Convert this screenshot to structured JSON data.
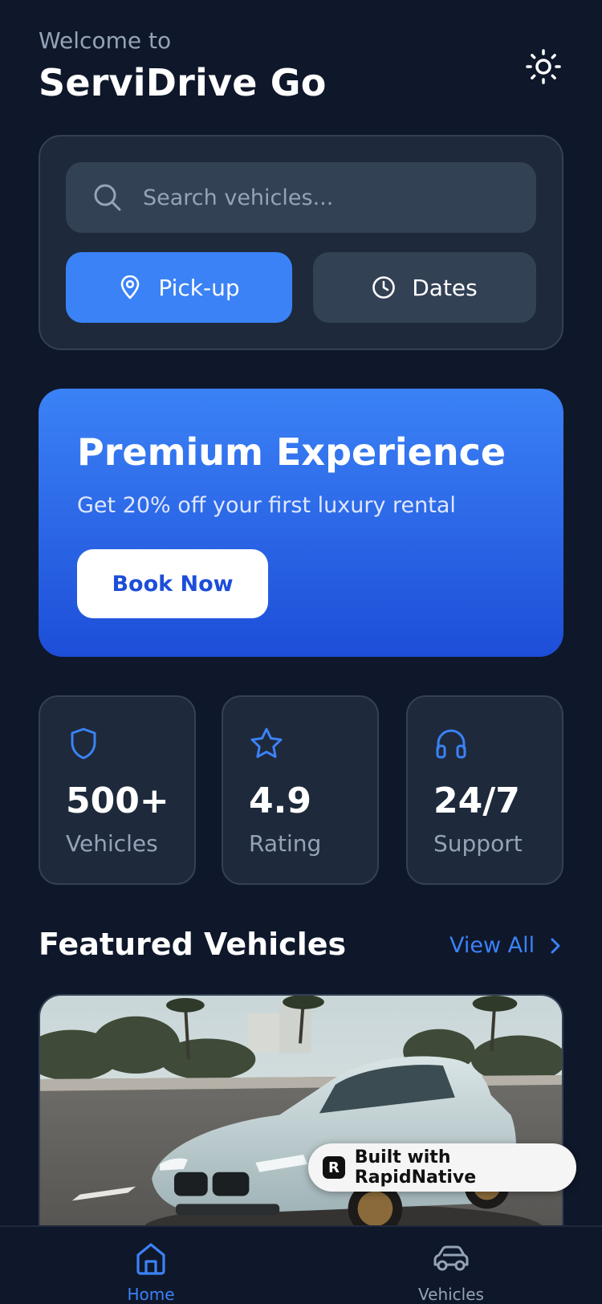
{
  "header": {
    "welcome": "Welcome to",
    "title": "ServiDrive Go",
    "theme_icon": "sun-icon"
  },
  "search": {
    "placeholder": "Search vehicles...",
    "value": "",
    "icon": "search-icon",
    "pickup_label": "Pick-up",
    "pickup_icon": "map-pin-icon",
    "dates_label": "Dates",
    "dates_icon": "clock-icon"
  },
  "promo": {
    "title": "Premium Experience",
    "subtitle": "Get 20% off your first luxury rental",
    "cta": "Book Now"
  },
  "stats": [
    {
      "value": "500+",
      "label": "Vehicles",
      "icon": "shield-icon"
    },
    {
      "value": "4.9",
      "label": "Rating",
      "icon": "star-icon"
    },
    {
      "value": "24/7",
      "label": "Support",
      "icon": "headphones-icon"
    }
  ],
  "featured": {
    "title": "Featured Vehicles",
    "view_all": "View All"
  },
  "badge": {
    "text": "Built with RapidNative",
    "logo_letter": "R"
  },
  "tabs": [
    {
      "label": "Home",
      "icon": "home-icon",
      "active": true
    },
    {
      "label": "Vehicles",
      "icon": "car-icon",
      "active": false
    }
  ],
  "colors": {
    "background": "#0f172a",
    "card": "#1e293b",
    "accent": "#3b82f6",
    "muted": "#94a3b8"
  }
}
